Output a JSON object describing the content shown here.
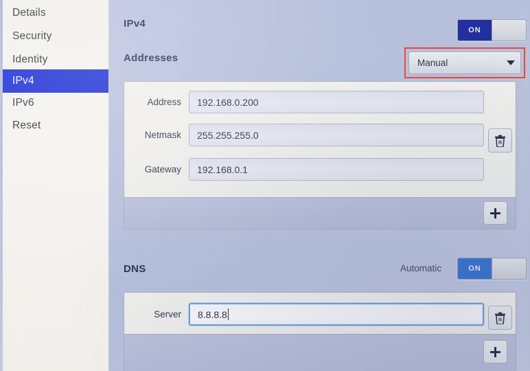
{
  "sidebar": {
    "items": [
      {
        "label": "Details",
        "selected": false
      },
      {
        "label": "Security",
        "selected": false
      },
      {
        "label": "Identity",
        "selected": false
      },
      {
        "label": "IPv4",
        "selected": true
      },
      {
        "label": "IPv6",
        "selected": false
      },
      {
        "label": "Reset",
        "selected": false
      }
    ]
  },
  "ipv4": {
    "title": "IPv4",
    "toggle_label": "ON",
    "toggle_state": "on",
    "toggle_color": "#1d2a9e"
  },
  "addresses": {
    "title": "Addresses",
    "mode_value": "Manual",
    "mode_icon": "chevron-down-icon",
    "highlight_color": "#f2402f",
    "rows": [
      {
        "label": "Address",
        "value": "192.168.0.200"
      },
      {
        "label": "Netmask",
        "value": "255.255.255.0"
      },
      {
        "label": "Gateway",
        "value": "192.168.0.1"
      }
    ],
    "delete_icon": "trash-icon",
    "add_icon": "plus-icon"
  },
  "dns": {
    "title": "DNS",
    "automatic_label": "Automatic",
    "toggle_label": "ON",
    "toggle_state": "on",
    "toggle_color": "#2f6fd0",
    "rows": [
      {
        "label": "Server",
        "value": "8.8.8.8",
        "focused": true
      }
    ],
    "delete_icon": "trash-icon",
    "add_icon": "plus-icon"
  }
}
